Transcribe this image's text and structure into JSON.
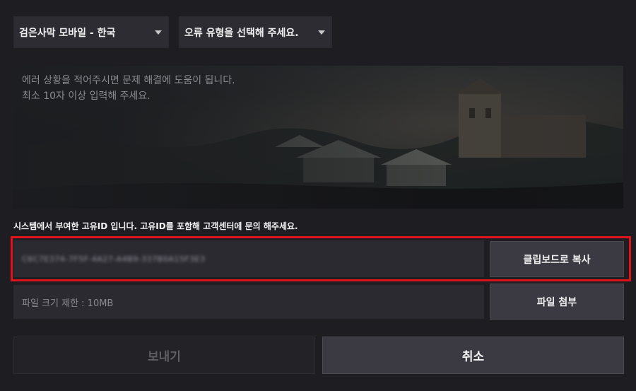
{
  "dropdowns": {
    "server": {
      "selected": "검은사막 모바일 - 한국"
    },
    "error_type": {
      "selected": "오류 유형을 선택해 주세요."
    }
  },
  "message": {
    "placeholder": "에러 상황을 적어주시면 문제 해결에 도움이 됩니다.\n최소 10자 이상 입력해 주세요.",
    "value": ""
  },
  "unique_id": {
    "notice": "시스템에서 부여한 고유ID 입니다. 고유ID를 포함해 고객센터에 문의 해주세요.",
    "value": "C6C7E374-7F5F-4A27-A4B9-337B0A15F3E3",
    "copy_button": "클립보드로 복사"
  },
  "attachment": {
    "limit_text": "파일 크기 제한 : 10MB",
    "attach_button": "파일 첨부"
  },
  "actions": {
    "send_button": "보내기",
    "cancel_button": "취소"
  },
  "colors": {
    "background": "#1e1d22",
    "panel": "#2b2a30",
    "button": "#3b3a42",
    "highlight": "#e0121c"
  },
  "icons": {
    "dropdown_caret": "caret-down-icon"
  }
}
